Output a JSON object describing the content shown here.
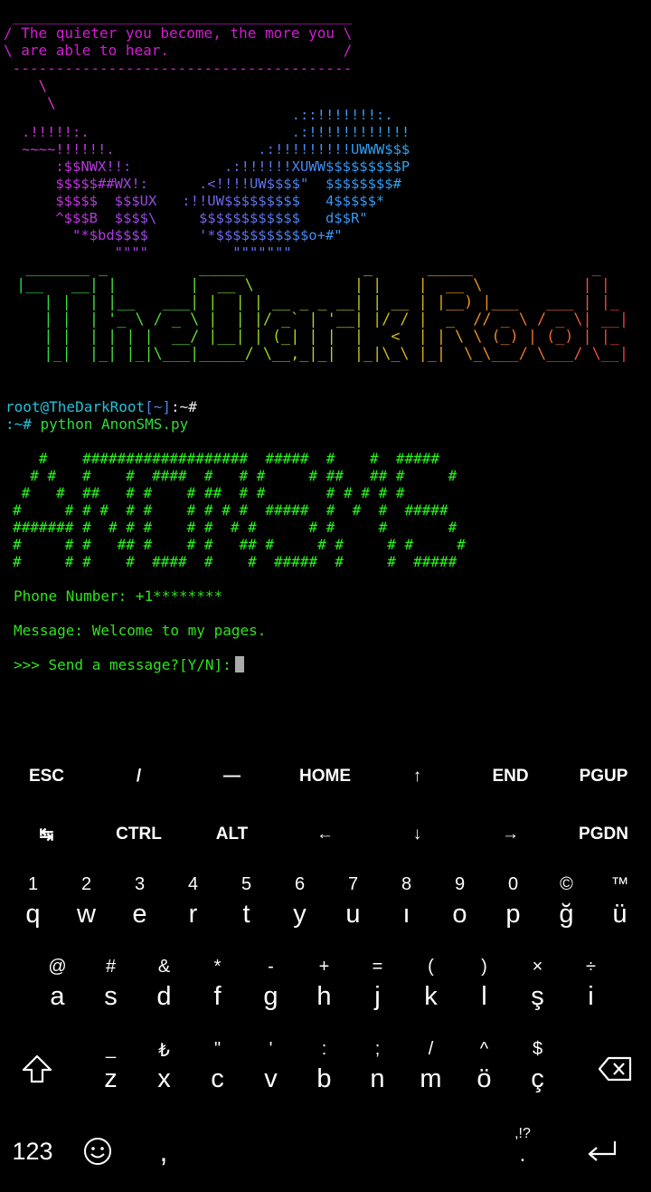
{
  "terminal": {
    "cowsay_bubble": " _______________________________________\n/ The quieter you become, the more you \\\n\\ are able to hear.                    /\n ---------------------------------------",
    "cowsay_cow": "    \\\n     \\",
    "dragon_art": "                                .::!!!!!!!:.\n.!!!!!:.                        .:!!!!!!!!!!!!\n~~~~!!!!!!.                 .:!!!!!!!!!UWWW$$$\n    :$$NWX!!:           .:!!!!!!XUWW$$$$$$$$$P\n    $$$$$##WX!:      .<!!!!UW$$$$\"  $$$$$$$$#\n    $$$$$  $$$UX   :!!UW$$$$$$$$$   4$$$$$*\n    ^$$$B  $$$$\\     $$$$$$$$$$$$   d$$R\"\n      \"*$bd$$$$      '*$$$$$$$$$$$o+#\"\n           \"\"\"\"          \"\"\"\"\"\"\"",
    "banner_art": "  _______ _          _____             _      _____             _   \n |__   __| |        |  __ \\           | |    |  __ \\           | |  \n    | |  | |__   ___| |  | | __ _ _ __| | __ | |__) |___   ___ | |_ \n    | |  | '_ \\ / _ \\ |  | |/ _` | '__| |/ / |  _  // _ \\ / _ \\| __|\n    | |  | | | |  __/ |__| | (_| | |  |   <  | | \\ \\ (_) | (_) | |_ \n    |_|  |_| |_|\\___|_____/ \\__,_|_|  |_|\\_\\ |_|  \\_\\___/ \\___/ \\__|",
    "prompt_user": "root@TheDarkRoot",
    "prompt_dir": "[~]",
    "prompt_tail": ":~#",
    "prompt2_prefix": ":~#",
    "command": " python AnonSMS.py",
    "anon_art": "   #    ###################  #####  #    #  #####\n  # #   #    #  ####  #   # #     # ##   ## #     #\n #   #  ##   # #    # ##  # #       # # # # #\n#     # # #  # #    # # # #  #####  #  #  #  #####\n####### #  # # #    # #  # #      # #     #       #\n#     # #   ## #    # #   ## #     # #     # #     #\n#     # #    #  ####  #    #  #####  #     #  #####",
    "phone_label": "Phone Number: ",
    "phone_value": "+1********",
    "message_label": "Message: ",
    "message_value": "Welcome to my pages.",
    "send_prompt": ">>> Send a message?[Y/N]:"
  },
  "extra_keys": {
    "row1": [
      "ESC",
      "/",
      "—",
      "HOME",
      "↑",
      "END",
      "PGUP"
    ],
    "row2": [
      "↹",
      "CTRL",
      "ALT",
      "←",
      "↓",
      "→",
      "PGDN"
    ]
  },
  "keyboard": {
    "row1": [
      {
        "hint": "1",
        "key": "q"
      },
      {
        "hint": "2",
        "key": "w"
      },
      {
        "hint": "3",
        "key": "e"
      },
      {
        "hint": "4",
        "key": "r"
      },
      {
        "hint": "5",
        "key": "t"
      },
      {
        "hint": "6",
        "key": "y"
      },
      {
        "hint": "7",
        "key": "u"
      },
      {
        "hint": "8",
        "key": "ı"
      },
      {
        "hint": "9",
        "key": "o"
      },
      {
        "hint": "0",
        "key": "p"
      },
      {
        "hint": "©",
        "key": "ğ"
      },
      {
        "hint": "™",
        "key": "ü"
      }
    ],
    "row2": [
      {
        "hint": "@",
        "key": "a"
      },
      {
        "hint": "#",
        "key": "s"
      },
      {
        "hint": "&",
        "key": "d"
      },
      {
        "hint": "*",
        "key": "f"
      },
      {
        "hint": "-",
        "key": "g"
      },
      {
        "hint": "+",
        "key": "h"
      },
      {
        "hint": "=",
        "key": "j"
      },
      {
        "hint": "(",
        "key": "k"
      },
      {
        "hint": ")",
        "key": "l"
      },
      {
        "hint": "×",
        "key": "ş"
      },
      {
        "hint": "÷",
        "key": "i"
      }
    ],
    "row3": [
      {
        "hint": "_",
        "key": "z"
      },
      {
        "hint": "₺",
        "key": "x"
      },
      {
        "hint": "\"",
        "key": "c"
      },
      {
        "hint": "'",
        "key": "v"
      },
      {
        "hint": ":",
        "key": "b"
      },
      {
        "hint": ";",
        "key": "n"
      },
      {
        "hint": "/",
        "key": "m"
      },
      {
        "hint": "^",
        "key": "ö"
      },
      {
        "hint": "$",
        "key": "ç"
      }
    ],
    "numbers_key": "123",
    "comma_key": ",",
    "period_hint": ",!?",
    "period_key": ".",
    "icons": {
      "shift": "shift-icon",
      "backspace": "backspace-icon",
      "emoji": "emoji-icon",
      "enter": "enter-icon"
    }
  },
  "colors": {
    "background": "#000000",
    "cowsay": "#d21dd2",
    "prompt_cyan": "#22c1d8",
    "output_green": "#2ee41c"
  }
}
